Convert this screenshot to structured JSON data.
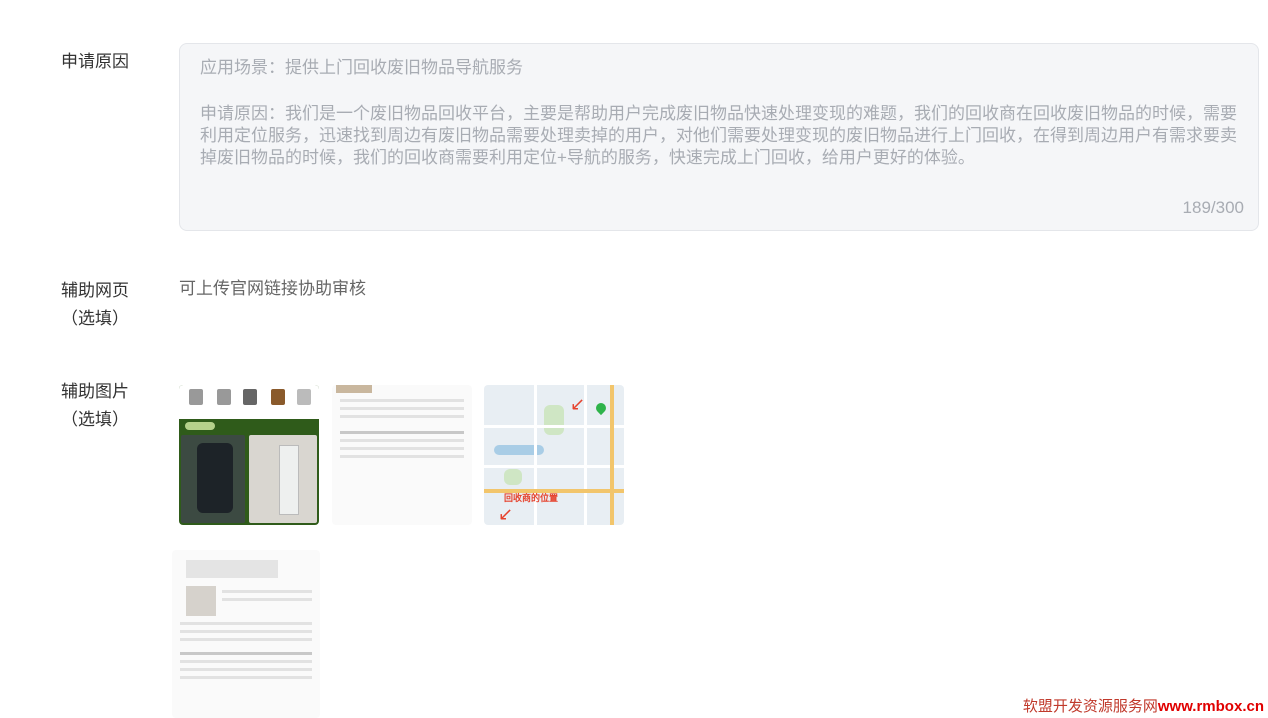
{
  "reason": {
    "label": "申请原因",
    "scenario": "应用场景：提供上门回收废旧物品导航服务",
    "reason_text": "申请原因：我们是一个废旧物品回收平台，主要是帮助用户完成废旧物品快速处理变现的难题，我们的回收商在回收废旧物品的时候，需要利用定位服务，迅速找到周边有废旧物品需要处理卖掉的用户，对他们需要处理变现的废旧物品进行上门回收，在得到周边用户有需求要卖掉废旧物品的时候，我们的回收商需要利用定位+导航的服务，快速完成上门回收，给用户更好的体验。",
    "counter": "189/300"
  },
  "web": {
    "label": "辅助网页",
    "optional": "（选填）",
    "hint": "可上传官网链接协助审核"
  },
  "images": {
    "label": "辅助图片",
    "optional": "（选填）",
    "map_label": "回收商的位置"
  },
  "watermark": {
    "cn": "软盟开发资源服务网",
    "url": "www.rmbox.cn"
  },
  "colors": {
    "placeholder": "#a8acb3",
    "field_bg": "#f5f6f8",
    "accent_red": "#e6432e"
  }
}
